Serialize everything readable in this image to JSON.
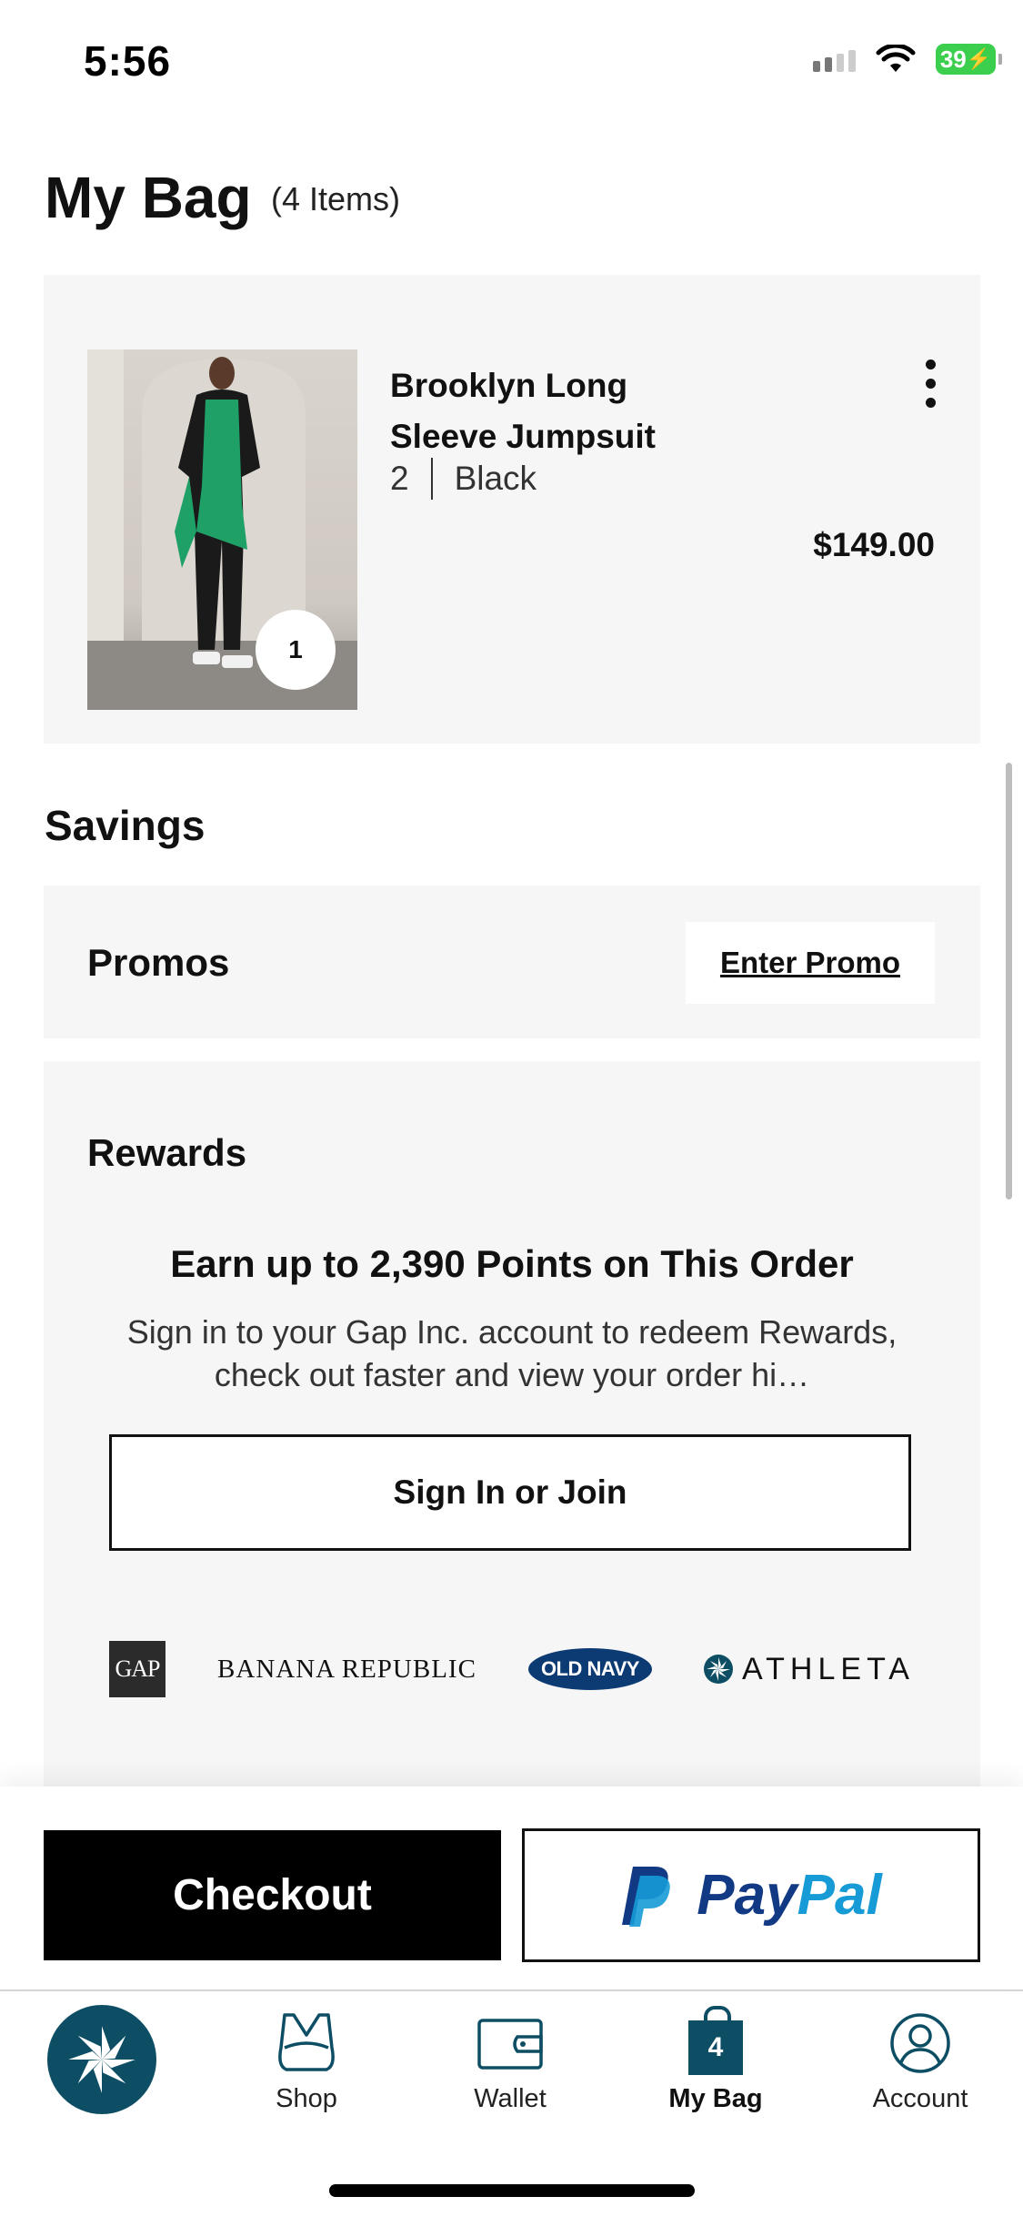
{
  "status": {
    "time": "5:56",
    "battery": "39"
  },
  "header": {
    "title": "My Bag",
    "count": "(4 Items)"
  },
  "item": {
    "name": "Brooklyn Long Sleeve Jumpsuit",
    "size": "2",
    "color": "Black",
    "price": "$149.00",
    "quantity": "1"
  },
  "savings": {
    "title": "Savings",
    "promos_label": "Promos",
    "enter_promo": "Enter Promo"
  },
  "rewards": {
    "title": "Rewards",
    "headline": "Earn up to 2,390 Points on This Order",
    "description": "Sign in to your Gap Inc. account to redeem Rewards, check out faster and view your order hi…",
    "button": "Sign In or Join",
    "brands": [
      "GAP",
      "BANANA REPUBLIC",
      "OLD NAVY",
      "ATHLETA"
    ]
  },
  "actions": {
    "checkout": "Checkout",
    "paypal_pay": "Pay",
    "paypal_pal": "Pal"
  },
  "tabs": [
    {
      "label": "Shop",
      "icon": "sports-bra-icon"
    },
    {
      "label": "Wallet",
      "icon": "wallet-icon"
    },
    {
      "label": "My Bag",
      "icon": "shopping-bag-icon",
      "badge": "4",
      "active": true
    },
    {
      "label": "Account",
      "icon": "account-icon"
    }
  ],
  "colors": {
    "brand_teal": "#0e4e64",
    "paypal_dark": "#123984",
    "paypal_light": "#169bd7",
    "old_navy": "#0c3a73"
  }
}
